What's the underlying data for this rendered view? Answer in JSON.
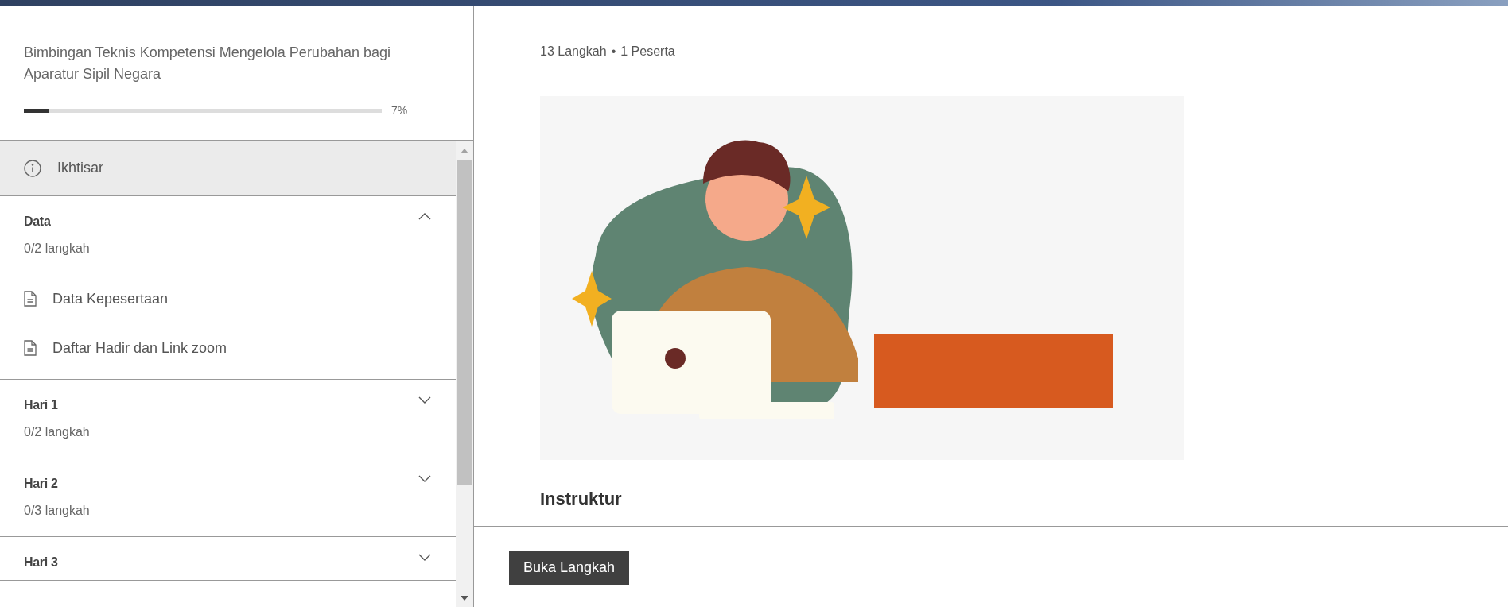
{
  "course": {
    "title": "Bimbingan Teknis Kompetensi Mengelola Perubahan bagi Aparatur Sipil Negara",
    "progress": {
      "level": 0.07,
      "reading": "7%"
    }
  },
  "overview": {
    "label": "Ikhtisar",
    "selected": true
  },
  "sections": [
    {
      "title": "Data",
      "progress": "0/2 langkah",
      "expanded": true,
      "steps": [
        {
          "label": "Data Kepesertaan"
        },
        {
          "label": "Daftar Hadir dan Link zoom"
        }
      ]
    },
    {
      "title": "Hari 1",
      "progress": "0/2 langkah",
      "expanded": false
    },
    {
      "title": "Hari 2",
      "progress": "0/3 langkah",
      "expanded": false
    },
    {
      "title": "Hari 3",
      "expanded": false
    }
  ],
  "meta": {
    "steps": "13 Langkah",
    "separator": "•",
    "participants": "1 Peserta"
  },
  "section_heading": "Instruktur",
  "primary_button": "Buka Langkah"
}
